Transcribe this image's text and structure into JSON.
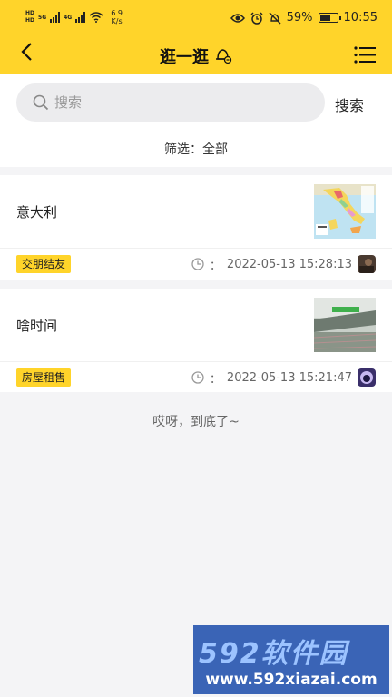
{
  "status_bar": {
    "network_labels": [
      "HD",
      "HD",
      "5G",
      "4G"
    ],
    "speed_value": "6.9",
    "speed_unit": "K/s",
    "battery_percent": "59%",
    "battery_level": 0.59,
    "time": "10:55",
    "icons": [
      "eye-icon",
      "alarm-icon",
      "mute-icon",
      "battery-icon"
    ]
  },
  "nav": {
    "title": "逛一逛",
    "icons": [
      "back-arrow-icon",
      "bell-icon",
      "list-menu-icon"
    ]
  },
  "search": {
    "placeholder": "搜索",
    "button_label": "搜索"
  },
  "filter": {
    "text": "筛选：全部"
  },
  "posts": [
    {
      "title": "意大利",
      "tag": "交朋结友",
      "time_prefix": "：",
      "time": "2022-05-13 15:28:13"
    },
    {
      "title": "啥时间",
      "tag": "房屋租售",
      "time_prefix": "：",
      "time": "2022-05-13 15:21:47"
    }
  ],
  "end_message": "哎呀，到底了~",
  "watermark": {
    "brand": "592软件园",
    "url": "www.592xiazai.com"
  },
  "colors": {
    "accent": "#ffd42a",
    "background": "#f4f4f6",
    "watermark": "#3a64b6"
  }
}
